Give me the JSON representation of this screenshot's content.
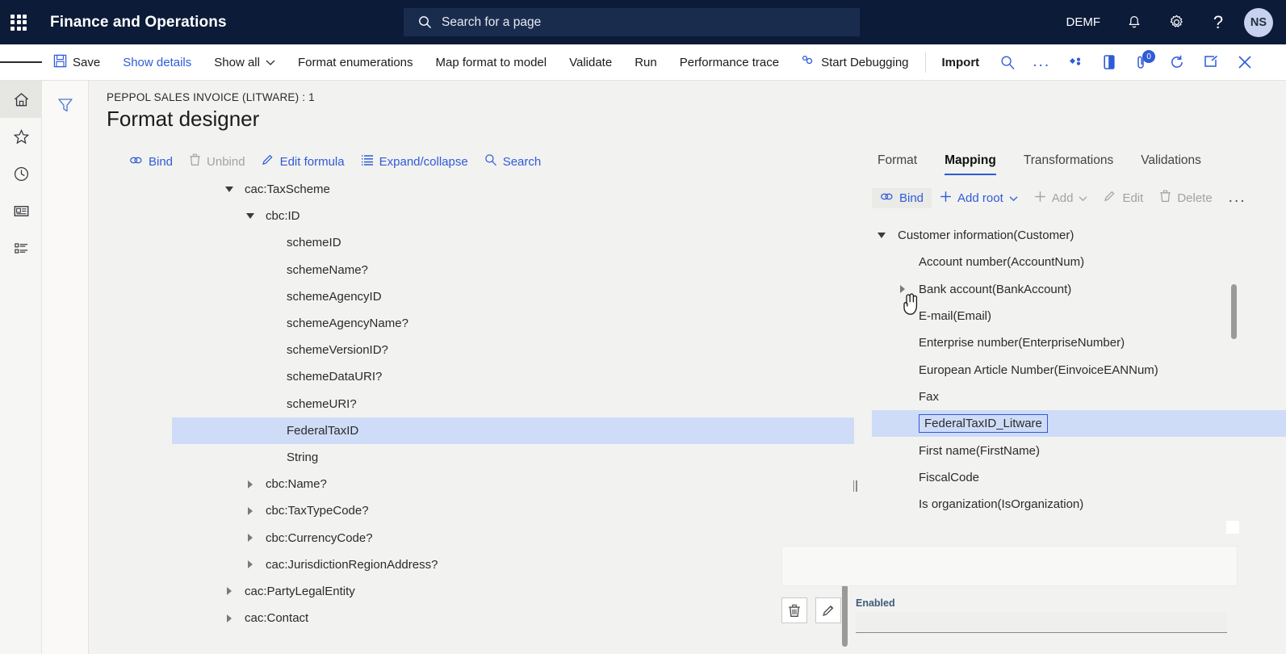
{
  "navbar": {
    "waffle_label": "App launcher",
    "app_title": "Finance and Operations",
    "search_placeholder": "Search for a page",
    "company": "DEMF",
    "avatar_initials": "NS"
  },
  "toolbar": {
    "save_label": "Save",
    "show_details_label": "Show details",
    "show_all_label": "Show all",
    "format_enumerations_label": "Format enumerations",
    "map_format_to_model_label": "Map format to model",
    "validate_label": "Validate",
    "run_label": "Run",
    "performance_trace_label": "Performance trace",
    "start_debugging_label": "Start Debugging",
    "import_label": "Import",
    "overflow_label": "...",
    "notification_badge": "0"
  },
  "page": {
    "breadcrumb": "PEPPOL SALES INVOICE (LITWARE) : 1",
    "title": "Format designer"
  },
  "left_commands": {
    "bind": "Bind",
    "unbind": "Unbind",
    "edit_formula": "Edit formula",
    "expand_collapse": "Expand/collapse",
    "search": "Search"
  },
  "left_tree": {
    "rows": [
      {
        "label": "cac:TaxScheme",
        "indent": 0,
        "toggle": "down",
        "selected": false
      },
      {
        "label": "cbc:ID",
        "indent": 1,
        "toggle": "down",
        "selected": false
      },
      {
        "label": "schemeID",
        "indent": 2,
        "toggle": "none",
        "selected": false
      },
      {
        "label": "schemeName?",
        "indent": 2,
        "toggle": "none",
        "selected": false
      },
      {
        "label": "schemeAgencyID",
        "indent": 2,
        "toggle": "none",
        "selected": false
      },
      {
        "label": "schemeAgencyName?",
        "indent": 2,
        "toggle": "none",
        "selected": false
      },
      {
        "label": "schemeVersionID?",
        "indent": 2,
        "toggle": "none",
        "selected": false
      },
      {
        "label": "schemeDataURI?",
        "indent": 2,
        "toggle": "none",
        "selected": false
      },
      {
        "label": "schemeURI?",
        "indent": 2,
        "toggle": "none",
        "selected": false
      },
      {
        "label": "FederalTaxID",
        "indent": 2,
        "toggle": "none",
        "selected": true
      },
      {
        "label": "String",
        "indent": 2,
        "toggle": "none",
        "selected": false
      },
      {
        "label": "cbc:Name?",
        "indent": 1,
        "toggle": "right",
        "selected": false
      },
      {
        "label": "cbc:TaxTypeCode?",
        "indent": 1,
        "toggle": "right",
        "selected": false
      },
      {
        "label": "cbc:CurrencyCode?",
        "indent": 1,
        "toggle": "right",
        "selected": false
      },
      {
        "label": "cac:JurisdictionRegionAddress?",
        "indent": 1,
        "toggle": "right",
        "selected": false
      },
      {
        "label": "cac:PartyLegalEntity",
        "indent": 0,
        "toggle": "right",
        "selected": false
      },
      {
        "label": "cac:Contact",
        "indent": 0,
        "toggle": "right",
        "selected": false
      }
    ]
  },
  "tabs": [
    {
      "label": "Format",
      "active": false
    },
    {
      "label": "Mapping",
      "active": true
    },
    {
      "label": "Transformations",
      "active": false
    },
    {
      "label": "Validations",
      "active": false
    }
  ],
  "right_commands": {
    "bind": "Bind",
    "add_root": "Add root",
    "add": "Add",
    "edit": "Edit",
    "delete": "Delete",
    "overflow": "..."
  },
  "right_tree": {
    "rows": [
      {
        "label": "Customer information(Customer)",
        "indent": 0,
        "toggle": "down",
        "selected": false,
        "focused": false
      },
      {
        "label": "Account number(AccountNum)",
        "indent": 1,
        "toggle": "none",
        "selected": false,
        "focused": false
      },
      {
        "label": "Bank account(BankAccount)",
        "indent": 1,
        "toggle": "right",
        "selected": false,
        "focused": false
      },
      {
        "label": "E-mail(Email)",
        "indent": 1,
        "toggle": "none",
        "selected": false,
        "focused": false
      },
      {
        "label": "Enterprise number(EnterpriseNumber)",
        "indent": 1,
        "toggle": "none",
        "selected": false,
        "focused": false
      },
      {
        "label": "European Article Number(EinvoiceEANNum)",
        "indent": 1,
        "toggle": "none",
        "selected": false,
        "focused": false
      },
      {
        "label": "Fax",
        "indent": 1,
        "toggle": "none",
        "selected": false,
        "focused": false
      },
      {
        "label": "FederalTaxID_Litware",
        "indent": 1,
        "toggle": "none",
        "selected": true,
        "focused": true
      },
      {
        "label": "First name(FirstName)",
        "indent": 1,
        "toggle": "none",
        "selected": false,
        "focused": false
      },
      {
        "label": "FiscalCode",
        "indent": 1,
        "toggle": "none",
        "selected": false,
        "focused": false
      },
      {
        "label": "Is organization(IsOrganization)",
        "indent": 1,
        "toggle": "none",
        "selected": false,
        "focused": false
      }
    ]
  },
  "property_panel": {
    "delete_button_label": "Delete",
    "edit_button_label": "Edit",
    "enabled_label": "Enabled",
    "enabled_value": ""
  },
  "colors": {
    "nav_background": "#0b1b38",
    "accent_link": "#2f5bd7",
    "selection": "#cfdcf7",
    "page_background": "#f2f2f0"
  }
}
